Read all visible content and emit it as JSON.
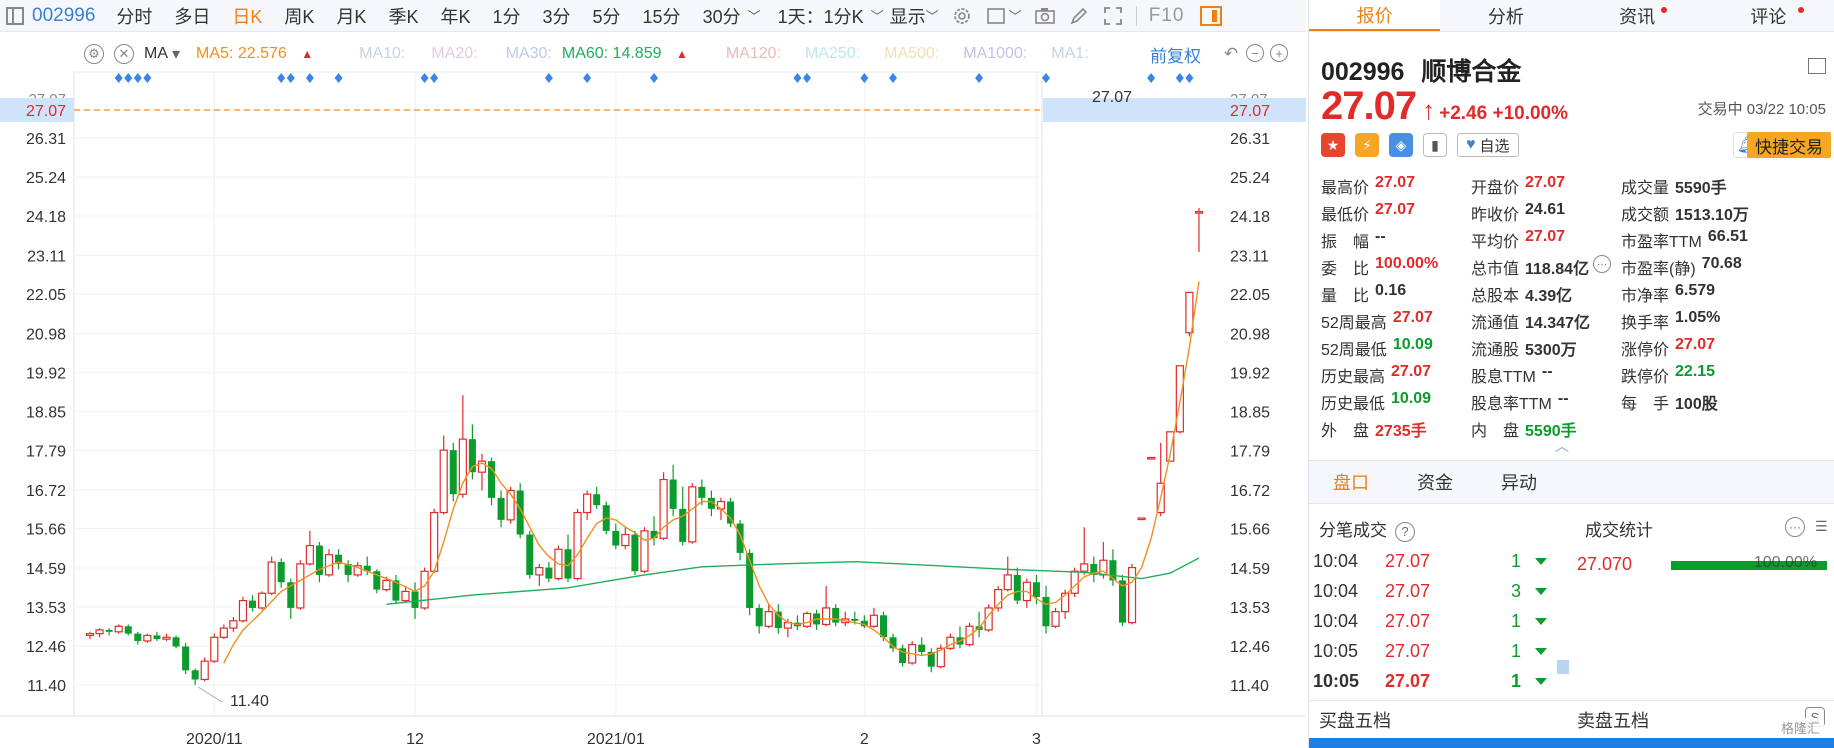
{
  "toolbar": {
    "code": "002996",
    "items": [
      "分时",
      "多日",
      "日K",
      "周K",
      "月K",
      "季K",
      "年K",
      "1分",
      "3分",
      "5分",
      "15分",
      "30分"
    ],
    "active_item": "日K",
    "mode_label": "1天：1分K",
    "display_label": "显示",
    "f10_label": "F10"
  },
  "ma_bar": {
    "type_label": "MA",
    "ma5": "MA5: 22.576",
    "ma10": "MA10:",
    "ma20": "MA20:",
    "ma30": "MA30:",
    "ma60": "MA60: 14.859",
    "ma120": "MA120:",
    "ma250": "MA250:",
    "ma500": "MA500:",
    "ma1000": "MA1000:",
    "ma1": "MA1:",
    "adjust_label": "前复权",
    "colors": {
      "ma5": "#f0901e",
      "ma60": "#1fae5b",
      "faded": "#c5d3e6"
    }
  },
  "chart_data": {
    "type": "candlestick",
    "yticks": [
      "27.07",
      "26.31",
      "25.24",
      "24.18",
      "23.11",
      "22.05",
      "20.98",
      "19.92",
      "18.85",
      "17.79",
      "16.72",
      "15.66",
      "14.59",
      "13.53",
      "12.46",
      "11.40"
    ],
    "top_tick": "27.07",
    "current_price_line": 27.07,
    "current_price_label": "27.07",
    "high_annotation": "27.07",
    "low_annotation": "11.40",
    "xticks": [
      {
        "label": "2020/11",
        "index": 13
      },
      {
        "label": "12",
        "index": 34
      },
      {
        "label": "2021/01",
        "index": 55
      },
      {
        "label": "2",
        "index": 81
      },
      {
        "label": "3",
        "index": 99
      }
    ],
    "marker_indices": [
      3,
      4,
      5,
      6,
      20,
      21,
      23,
      26,
      35,
      36,
      48,
      52,
      59,
      74,
      75,
      81,
      84,
      93,
      100,
      111,
      114,
      115
    ],
    "ohlc": [
      [
        12.75,
        12.85,
        12.65,
        12.8
      ],
      [
        12.8,
        12.95,
        12.7,
        12.9
      ],
      [
        12.9,
        12.95,
        12.75,
        12.85
      ],
      [
        12.85,
        13.05,
        12.8,
        13.0
      ],
      [
        13.0,
        13.05,
        12.75,
        12.8
      ],
      [
        12.8,
        12.85,
        12.5,
        12.6
      ],
      [
        12.6,
        12.8,
        12.55,
        12.75
      ],
      [
        12.75,
        12.85,
        12.6,
        12.65
      ],
      [
        12.65,
        12.8,
        12.6,
        12.7
      ],
      [
        12.7,
        12.75,
        12.4,
        12.45
      ],
      [
        12.45,
        12.55,
        11.7,
        11.8
      ],
      [
        11.8,
        11.85,
        11.4,
        11.55
      ],
      [
        11.55,
        12.15,
        11.5,
        12.05
      ],
      [
        12.05,
        12.8,
        12.0,
        12.7
      ],
      [
        12.7,
        13.05,
        12.65,
        12.95
      ],
      [
        12.95,
        13.25,
        12.85,
        13.15
      ],
      [
        13.15,
        13.8,
        13.1,
        13.7
      ],
      [
        13.7,
        13.85,
        13.4,
        13.5
      ],
      [
        13.5,
        13.95,
        13.45,
        13.9
      ],
      [
        13.9,
        14.9,
        13.85,
        14.75
      ],
      [
        14.75,
        14.85,
        14.05,
        14.2
      ],
      [
        14.2,
        14.3,
        13.2,
        13.5
      ],
      [
        13.5,
        14.8,
        13.45,
        14.7
      ],
      [
        14.7,
        15.6,
        14.65,
        15.2
      ],
      [
        15.2,
        15.3,
        14.2,
        14.4
      ],
      [
        14.4,
        15.1,
        14.35,
        14.95
      ],
      [
        14.95,
        15.1,
        14.55,
        14.7
      ],
      [
        14.7,
        14.8,
        14.2,
        14.4
      ],
      [
        14.4,
        14.75,
        14.35,
        14.65
      ],
      [
        14.65,
        14.9,
        14.4,
        14.5
      ],
      [
        14.5,
        14.55,
        13.9,
        14.0
      ],
      [
        14.0,
        14.35,
        13.95,
        14.25
      ],
      [
        14.25,
        14.4,
        13.6,
        13.7
      ],
      [
        13.7,
        14.1,
        13.65,
        13.95
      ],
      [
        13.95,
        14.2,
        13.2,
        13.5
      ],
      [
        13.5,
        14.6,
        13.45,
        14.5
      ],
      [
        14.5,
        16.2,
        14.45,
        16.1
      ],
      [
        16.1,
        18.2,
        16.05,
        17.8
      ],
      [
        17.8,
        18.0,
        16.4,
        16.6
      ],
      [
        16.6,
        19.3,
        16.5,
        18.1
      ],
      [
        18.1,
        18.5,
        17.0,
        17.2
      ],
      [
        17.2,
        17.7,
        16.7,
        17.5
      ],
      [
        17.5,
        17.6,
        16.3,
        16.5
      ],
      [
        16.5,
        16.7,
        15.7,
        15.9
      ],
      [
        15.9,
        16.8,
        15.8,
        16.7
      ],
      [
        16.7,
        16.9,
        15.4,
        15.5
      ],
      [
        15.5,
        15.6,
        14.3,
        14.4
      ],
      [
        14.4,
        14.7,
        14.1,
        14.6
      ],
      [
        14.6,
        14.75,
        14.2,
        14.3
      ],
      [
        14.3,
        15.2,
        14.25,
        15.1
      ],
      [
        15.1,
        15.5,
        14.2,
        14.3
      ],
      [
        14.3,
        16.2,
        14.25,
        16.1
      ],
      [
        16.1,
        16.7,
        15.9,
        16.6
      ],
      [
        16.6,
        16.8,
        16.2,
        16.3
      ],
      [
        16.3,
        16.4,
        15.5,
        15.6
      ],
      [
        15.6,
        15.8,
        15.1,
        15.2
      ],
      [
        15.2,
        15.7,
        15.1,
        15.5
      ],
      [
        15.5,
        15.6,
        14.4,
        14.5
      ],
      [
        14.5,
        15.7,
        14.45,
        15.6
      ],
      [
        15.6,
        16.0,
        15.2,
        15.4
      ],
      [
        15.4,
        17.2,
        15.35,
        17.0
      ],
      [
        17.0,
        17.4,
        16.0,
        16.2
      ],
      [
        16.2,
        16.8,
        15.2,
        15.3
      ],
      [
        15.3,
        16.9,
        15.25,
        16.8
      ],
      [
        16.8,
        17.0,
        16.3,
        16.5
      ],
      [
        16.5,
        16.7,
        16.0,
        16.2
      ],
      [
        16.2,
        16.5,
        15.9,
        16.4
      ],
      [
        16.4,
        16.5,
        15.7,
        15.8
      ],
      [
        15.8,
        15.9,
        14.8,
        15.0
      ],
      [
        15.0,
        15.1,
        13.3,
        13.5
      ],
      [
        13.5,
        13.6,
        12.8,
        13.0
      ],
      [
        13.0,
        13.6,
        12.95,
        13.4
      ],
      [
        13.4,
        13.6,
        12.8,
        12.95
      ],
      [
        12.95,
        13.2,
        12.7,
        13.1
      ],
      [
        13.1,
        13.3,
        12.9,
        13.0
      ],
      [
        13.0,
        13.4,
        12.95,
        13.35
      ],
      [
        13.35,
        13.45,
        12.9,
        13.05
      ],
      [
        13.05,
        14.1,
        13.0,
        13.5
      ],
      [
        13.5,
        13.6,
        13.0,
        13.1
      ],
      [
        13.1,
        13.4,
        13.0,
        13.2
      ],
      [
        13.2,
        13.4,
        13.05,
        13.15
      ],
      [
        13.15,
        13.3,
        12.95,
        13.0
      ],
      [
        13.0,
        13.5,
        12.95,
        13.3
      ],
      [
        13.3,
        13.4,
        12.6,
        12.7
      ],
      [
        12.7,
        12.8,
        12.3,
        12.4
      ],
      [
        12.4,
        12.5,
        11.9,
        12.0
      ],
      [
        12.0,
        12.6,
        11.95,
        12.5
      ],
      [
        12.5,
        12.7,
        12.2,
        12.3
      ],
      [
        12.3,
        12.4,
        11.75,
        11.9
      ],
      [
        11.9,
        12.5,
        11.85,
        12.4
      ],
      [
        12.4,
        12.8,
        12.35,
        12.7
      ],
      [
        12.7,
        13.0,
        12.4,
        12.5
      ],
      [
        12.5,
        13.1,
        12.45,
        13.0
      ],
      [
        13.0,
        13.4,
        12.7,
        12.9
      ],
      [
        12.9,
        13.6,
        12.85,
        13.5
      ],
      [
        13.5,
        14.1,
        13.4,
        14.0
      ],
      [
        14.0,
        14.9,
        13.95,
        14.4
      ],
      [
        14.4,
        14.6,
        13.6,
        13.7
      ],
      [
        13.7,
        14.3,
        13.5,
        14.2
      ],
      [
        14.2,
        14.4,
        13.6,
        13.8
      ],
      [
        13.8,
        14.1,
        12.8,
        13.0
      ],
      [
        13.0,
        13.5,
        12.95,
        13.4
      ],
      [
        13.4,
        14.0,
        13.2,
        13.9
      ],
      [
        13.9,
        14.6,
        13.8,
        14.5
      ],
      [
        14.5,
        15.7,
        14.4,
        14.7
      ],
      [
        14.7,
        14.9,
        14.2,
        14.4
      ],
      [
        14.4,
        15.3,
        14.3,
        14.8
      ],
      [
        14.8,
        15.1,
        14.1,
        14.25
      ],
      [
        14.25,
        14.4,
        13.0,
        13.1
      ],
      [
        13.1,
        14.7,
        13.05,
        14.6
      ],
      [
        15.95,
        15.95,
        15.95,
        15.95
      ],
      [
        17.6,
        17.6,
        17.6,
        17.6
      ],
      [
        16.1,
        18.0,
        16.0,
        16.9
      ],
      [
        17.5,
        18.3,
        17.5,
        18.3
      ],
      [
        18.3,
        20.1,
        18.25,
        20.1
      ],
      [
        21.0,
        22.1,
        20.9,
        22.1
      ],
      [
        24.3,
        24.4,
        23.2,
        24.3
      ]
    ],
    "ma5": [
      [
        14,
        12.0
      ],
      [
        15,
        12.5
      ],
      [
        16,
        12.9
      ],
      [
        18,
        13.4
      ],
      [
        20,
        13.95
      ],
      [
        22,
        14.25
      ],
      [
        24,
        14.55
      ],
      [
        26,
        14.75
      ],
      [
        28,
        14.6
      ],
      [
        30,
        14.4
      ],
      [
        32,
        14.2
      ],
      [
        34,
        13.95
      ],
      [
        35,
        14.1
      ],
      [
        36,
        14.5
      ],
      [
        37,
        15.3
      ],
      [
        38,
        16.2
      ],
      [
        39,
        16.9
      ],
      [
        40,
        17.35
      ],
      [
        41,
        17.45
      ],
      [
        42,
        17.3
      ],
      [
        43,
        16.9
      ],
      [
        44,
        16.6
      ],
      [
        45,
        16.2
      ],
      [
        46,
        15.7
      ],
      [
        47,
        15.2
      ],
      [
        48,
        14.9
      ],
      [
        49,
        14.7
      ],
      [
        50,
        14.65
      ],
      [
        51,
        14.95
      ],
      [
        52,
        15.4
      ],
      [
        53,
        15.8
      ],
      [
        54,
        15.95
      ],
      [
        55,
        15.9
      ],
      [
        56,
        15.7
      ],
      [
        57,
        15.55
      ],
      [
        58,
        15.35
      ],
      [
        59,
        15.4
      ],
      [
        60,
        15.7
      ],
      [
        61,
        15.9
      ],
      [
        62,
        16.0
      ],
      [
        63,
        16.2
      ],
      [
        64,
        16.4
      ],
      [
        65,
        16.4
      ],
      [
        66,
        16.2
      ],
      [
        67,
        15.95
      ],
      [
        68,
        15.5
      ],
      [
        69,
        14.8
      ],
      [
        70,
        14.1
      ],
      [
        71,
        13.6
      ],
      [
        72,
        13.3
      ],
      [
        73,
        13.1
      ],
      [
        74,
        13.05
      ],
      [
        75,
        13.1
      ],
      [
        76,
        13.2
      ],
      [
        77,
        13.2
      ],
      [
        78,
        13.2
      ],
      [
        79,
        13.15
      ],
      [
        80,
        13.1
      ],
      [
        81,
        13.05
      ],
      [
        82,
        12.9
      ],
      [
        83,
        12.7
      ],
      [
        84,
        12.45
      ],
      [
        85,
        12.3
      ],
      [
        86,
        12.25
      ],
      [
        87,
        12.2
      ],
      [
        88,
        12.25
      ],
      [
        89,
        12.35
      ],
      [
        90,
        12.5
      ],
      [
        91,
        12.6
      ],
      [
        92,
        12.75
      ],
      [
        93,
        12.95
      ],
      [
        94,
        13.3
      ],
      [
        95,
        13.6
      ],
      [
        96,
        13.85
      ],
      [
        97,
        13.95
      ],
      [
        98,
        13.95
      ],
      [
        99,
        13.75
      ],
      [
        100,
        13.6
      ],
      [
        101,
        13.65
      ],
      [
        102,
        13.85
      ],
      [
        103,
        14.1
      ],
      [
        104,
        14.35
      ],
      [
        105,
        14.45
      ],
      [
        106,
        14.5
      ],
      [
        107,
        14.3
      ],
      [
        108,
        14.1
      ],
      [
        109,
        14.2
      ],
      [
        110,
        14.6
      ],
      [
        111,
        15.4
      ],
      [
        112,
        16.5
      ],
      [
        113,
        17.7
      ],
      [
        114,
        19.1
      ],
      [
        115,
        20.6
      ],
      [
        116,
        22.4
      ]
    ],
    "ma60": [
      [
        31,
        13.6
      ],
      [
        40,
        13.85
      ],
      [
        50,
        14.05
      ],
      [
        58,
        14.4
      ],
      [
        64,
        14.62
      ],
      [
        72,
        14.7
      ],
      [
        80,
        14.76
      ],
      [
        88,
        14.66
      ],
      [
        96,
        14.55
      ],
      [
        104,
        14.47
      ],
      [
        110,
        14.3
      ],
      [
        113,
        14.45
      ],
      [
        116,
        14.86
      ]
    ]
  },
  "right_panel": {
    "tabs": [
      {
        "label": "报价",
        "dot": false
      },
      {
        "label": "分析",
        "dot": false
      },
      {
        "label": "资讯",
        "dot": true
      },
      {
        "label": "评论",
        "dot": true
      }
    ],
    "code": "002996",
    "name": "顺博合金",
    "price": "27.07",
    "change": "+2.46",
    "change_pct": "+10.00%",
    "trade_status": "交易中 03/22 10:05",
    "add_watch_label": "自选",
    "fast_trade_label": "快捷交易",
    "quote_cols": [
      [
        {
          "k": "最高价",
          "v": "27.07",
          "c": "red"
        },
        {
          "k": "最低价",
          "v": "27.07",
          "c": "red"
        },
        {
          "k": "振　幅",
          "v": "--",
          "c": ""
        },
        {
          "k": "委　比",
          "v": "100.00%",
          "c": "red"
        },
        {
          "k": "量　比",
          "v": "0.16",
          "c": ""
        },
        {
          "k": "52周最高",
          "v": "27.07",
          "c": "red"
        },
        {
          "k": "52周最低",
          "v": "10.09",
          "c": "green"
        },
        {
          "k": "历史最高",
          "v": "27.07",
          "c": "red"
        },
        {
          "k": "历史最低",
          "v": "10.09",
          "c": "green"
        },
        {
          "k": "外　盘",
          "v": "2735手",
          "c": "red"
        }
      ],
      [
        {
          "k": "开盘价",
          "v": "27.07",
          "c": "red"
        },
        {
          "k": "昨收价",
          "v": "24.61",
          "c": ""
        },
        {
          "k": "平均价",
          "v": "27.07",
          "c": "red"
        },
        {
          "k": "总市值",
          "v": "118.84亿",
          "c": ""
        },
        {
          "k": "总股本",
          "v": "4.39亿",
          "c": ""
        },
        {
          "k": "流通值",
          "v": "14.347亿",
          "c": ""
        },
        {
          "k": "流通股",
          "v": "5300万",
          "c": ""
        },
        {
          "k": "股息TTM",
          "v": "--",
          "c": ""
        },
        {
          "k": "股息率TTM",
          "v": "--",
          "c": ""
        },
        {
          "k": "内　盘",
          "v": "5590手",
          "c": "green"
        }
      ],
      [
        {
          "k": "成交量",
          "v": "5590手",
          "c": ""
        },
        {
          "k": "成交额",
          "v": "1513.10万",
          "c": ""
        },
        {
          "k": "市盈率TTM",
          "v": "66.51",
          "c": ""
        },
        {
          "k": "市盈率(静)",
          "v": "70.68",
          "c": ""
        },
        {
          "k": "市净率",
          "v": "6.579",
          "c": ""
        },
        {
          "k": "换手率",
          "v": "1.05%",
          "c": ""
        },
        {
          "k": "涨停价",
          "v": "27.07",
          "c": "red"
        },
        {
          "k": "跌停价",
          "v": "22.15",
          "c": "green"
        },
        {
          "k": "每　手",
          "v": "100股",
          "c": ""
        }
      ]
    ],
    "sub_tabs": [
      "盘口",
      "资金",
      "异动"
    ],
    "active_sub_tab": "盘口",
    "tick_title": "分笔成交",
    "stat_title": "成交统计",
    "ticks": [
      {
        "time": "10:04",
        "price": "27.07",
        "vol": "1"
      },
      {
        "time": "10:04",
        "price": "27.07",
        "vol": "3"
      },
      {
        "time": "10:04",
        "price": "27.07",
        "vol": "1"
      },
      {
        "time": "10:05",
        "price": "27.07",
        "vol": "1"
      },
      {
        "time": "10:05",
        "price": "27.07",
        "vol": "1"
      }
    ],
    "stat_price": "27.070",
    "stat_pct": "100.00%",
    "buy_five": "买盘五档",
    "sell_five": "卖盘五档",
    "watermark": "格隆汇"
  }
}
